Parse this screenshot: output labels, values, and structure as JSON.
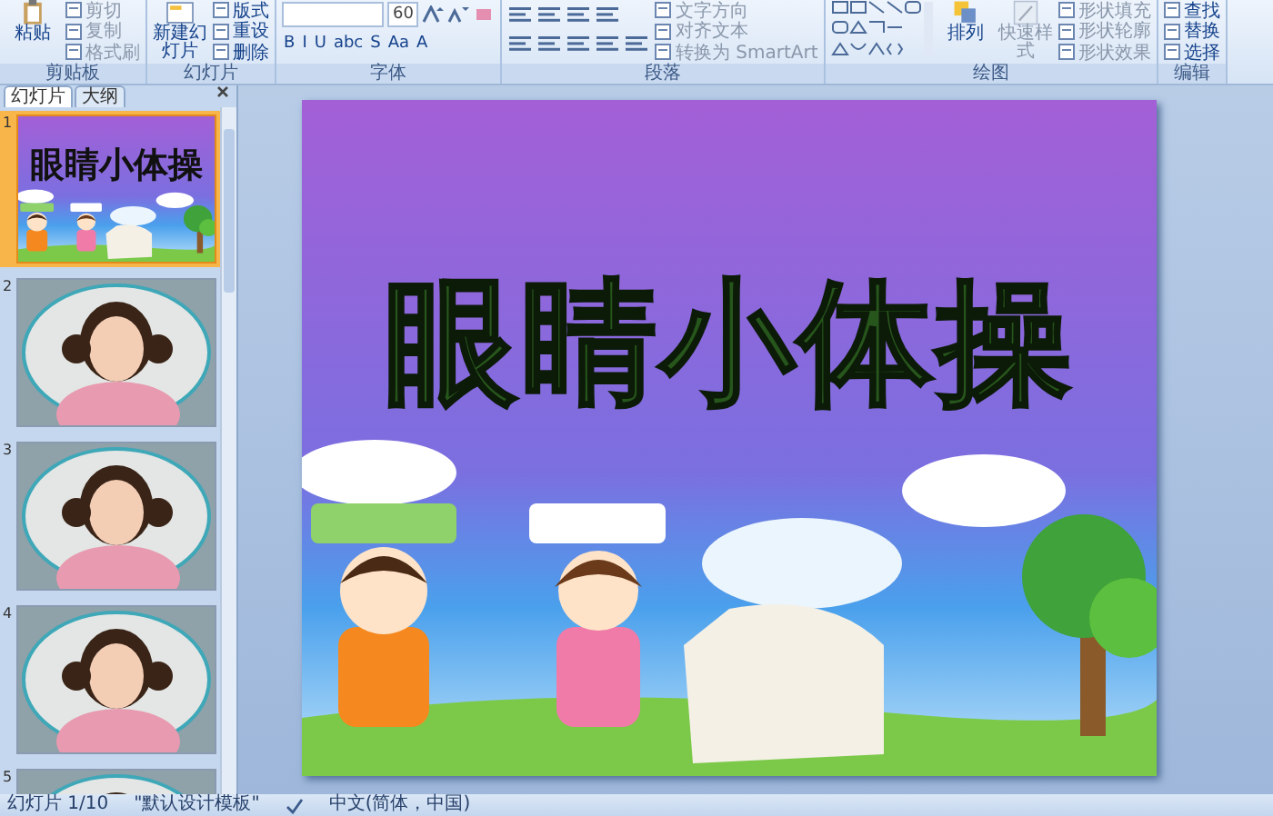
{
  "ribbon": {
    "groups": [
      {
        "kind": "clipboard",
        "label": "剪贴板",
        "large": [
          {
            "label": "粘贴",
            "disabled": false
          }
        ],
        "small": [
          {
            "label": "剪切",
            "disabled": true
          },
          {
            "label": "复制",
            "disabled": true
          },
          {
            "label": "格式刷",
            "disabled": true
          }
        ]
      },
      {
        "kind": "slides",
        "label": "幻灯片",
        "large": [
          {
            "label": "新建幻灯片",
            "disabled": false
          }
        ],
        "small": [
          {
            "label": "版式",
            "disabled": false
          },
          {
            "label": "重设",
            "disabled": false
          },
          {
            "label": "删除",
            "disabled": false
          }
        ]
      },
      {
        "kind": "font",
        "label": "字体",
        "size_value": "60",
        "format_buttons": [
          "B",
          "I",
          "U",
          "abc",
          "S",
          "Aa",
          "A"
        ]
      },
      {
        "kind": "paragraph",
        "label": "段落",
        "small": [
          {
            "label": "文字方向",
            "disabled": true
          },
          {
            "label": "对齐文本",
            "disabled": true
          },
          {
            "label": "转换为 SmartArt",
            "disabled": true
          }
        ]
      },
      {
        "kind": "drawing",
        "label": "绘图",
        "large": [
          {
            "label": "排列",
            "disabled": false
          },
          {
            "label": "快速样式",
            "disabled": true
          }
        ],
        "small": [
          {
            "label": "形状填充",
            "disabled": true
          },
          {
            "label": "形状轮廓",
            "disabled": true
          },
          {
            "label": "形状效果",
            "disabled": true
          }
        ]
      },
      {
        "kind": "editing",
        "label": "编辑",
        "small": [
          {
            "label": "查找",
            "disabled": false
          },
          {
            "label": "替换",
            "disabled": false
          },
          {
            "label": "选择",
            "disabled": false
          }
        ]
      }
    ]
  },
  "panel": {
    "tabs": [
      {
        "label": "幻灯片",
        "selected": true
      },
      {
        "label": "大纲",
        "selected": false
      }
    ],
    "thumbnails": [
      {
        "number": "1",
        "kind": "title",
        "title": "眼睛小体操",
        "selected": true
      },
      {
        "number": "2",
        "selected": false
      },
      {
        "number": "3",
        "selected": false
      },
      {
        "number": "4",
        "selected": false
      },
      {
        "number": "5",
        "selected": false
      }
    ]
  },
  "slide": {
    "title": "眼睛小体操"
  },
  "status_bar": {
    "slide_position": "幻灯片 1/10",
    "theme": "\"默认设计模板\"",
    "language": "中文(简体，中国)"
  }
}
